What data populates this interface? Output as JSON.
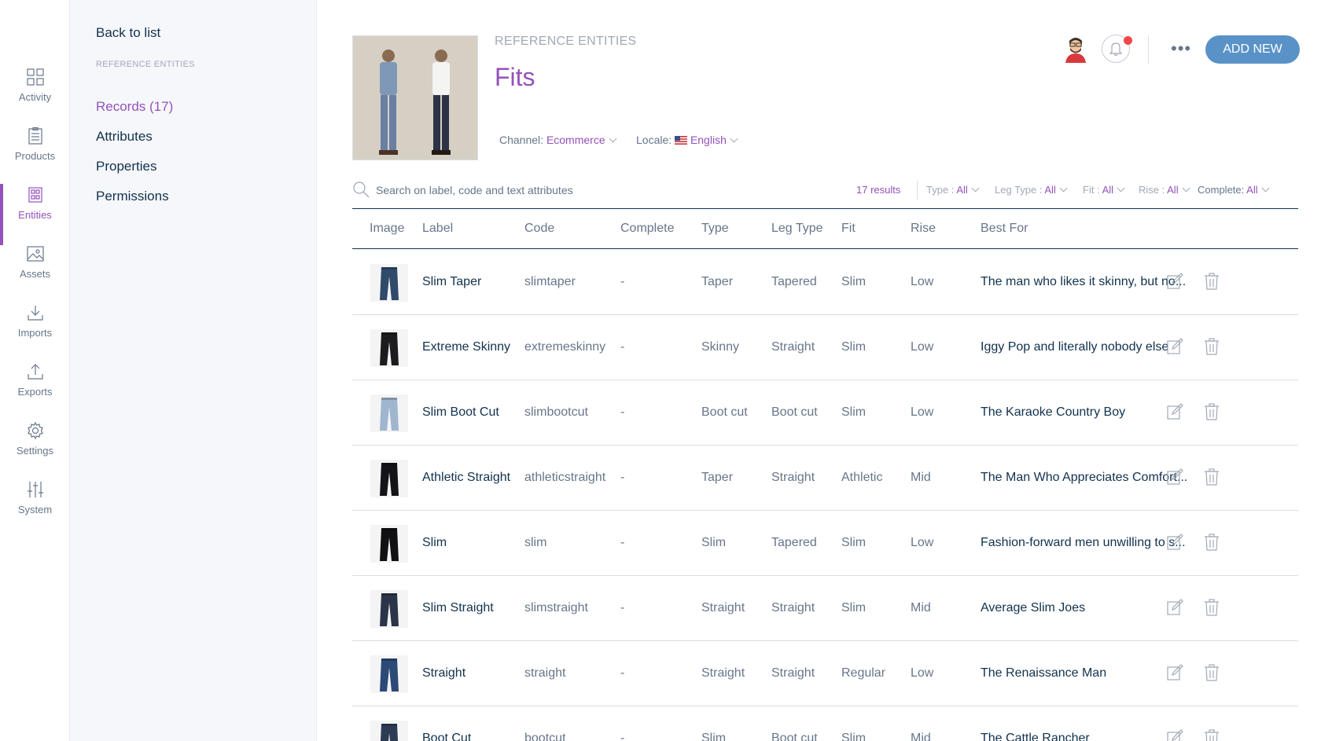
{
  "nav": [
    {
      "label": "Activity",
      "icon": "dashboard-icon"
    },
    {
      "label": "Products",
      "icon": "clipboard-icon"
    },
    {
      "label": "Entities",
      "icon": "entities-icon"
    },
    {
      "label": "Assets",
      "icon": "image-icon"
    },
    {
      "label": "Imports",
      "icon": "download-icon"
    },
    {
      "label": "Exports",
      "icon": "upload-icon"
    },
    {
      "label": "Settings",
      "icon": "gear-icon"
    },
    {
      "label": "System",
      "icon": "sliders-icon"
    }
  ],
  "subnav": {
    "back": "Back to list",
    "section": "REFERENCE ENTITIES",
    "items": [
      "Records (17)",
      "Attributes",
      "Properties",
      "Permissions"
    ]
  },
  "header": {
    "breadcrumb": "REFERENCE ENTITIES",
    "title": "Fits",
    "channel_label": "Channel:",
    "channel_value": "Ecommerce",
    "locale_label": "Locale:",
    "locale_value": "English",
    "add_button": "ADD NEW",
    "more": "•••"
  },
  "search": {
    "placeholder": "Search on label, code and text attributes",
    "results": "17 results",
    "filters": [
      {
        "label": "Type :",
        "value": "All"
      },
      {
        "label": "Leg Type :",
        "value": "All"
      },
      {
        "label": "Fit :",
        "value": "All"
      },
      {
        "label": "Rise :",
        "value": "All"
      },
      {
        "label": "Complete:",
        "value": "All"
      }
    ]
  },
  "table": {
    "columns": [
      "Image",
      "Label",
      "Code",
      "Complete",
      "Type",
      "Leg Type",
      "Fit",
      "Rise",
      "Best For"
    ],
    "rows": [
      {
        "label": "Slim Taper",
        "code": "slimtaper",
        "complete": "-",
        "type": "Taper",
        "leg": "Tapered",
        "fit": "Slim",
        "rise": "Low",
        "best": "The man who likes it skinny, but no..."
      },
      {
        "label": "Extreme Skinny",
        "code": "extremeskinny",
        "complete": "-",
        "type": "Skinny",
        "leg": "Straight",
        "fit": "Slim",
        "rise": "Low",
        "best": "Iggy Pop and literally nobody else"
      },
      {
        "label": "Slim Boot Cut",
        "code": "slimbootcut",
        "complete": "-",
        "type": "Boot cut",
        "leg": "Boot cut",
        "fit": "Slim",
        "rise": "Low",
        "best": "The Karaoke Country Boy"
      },
      {
        "label": "Athletic Straight",
        "code": "athleticstraight",
        "complete": "-",
        "type": "Taper",
        "leg": "Straight",
        "fit": "Athletic",
        "rise": "Mid",
        "best": "The Man Who Appreciates Comfort..."
      },
      {
        "label": "Slim",
        "code": "slim",
        "complete": "-",
        "type": "Slim",
        "leg": "Tapered",
        "fit": "Slim",
        "rise": "Low",
        "best": "Fashion-forward men unwilling to s..."
      },
      {
        "label": "Slim Straight",
        "code": "slimstraight",
        "complete": "-",
        "type": "Straight",
        "leg": "Straight",
        "fit": "Slim",
        "rise": "Mid",
        "best": "Average Slim Joes"
      },
      {
        "label": "Straight",
        "code": "straight",
        "complete": "-",
        "type": "Straight",
        "leg": "Straight",
        "fit": "Regular",
        "rise": "Low",
        "best": "The Renaissance Man"
      },
      {
        "label": "Boot Cut",
        "code": "bootcut",
        "complete": "-",
        "type": "Slim",
        "leg": "Boot cut",
        "fit": "Slim",
        "rise": "Mid",
        "best": "The Cattle Rancher"
      }
    ]
  },
  "colors": {
    "accent": "#9452ba",
    "button": "#5992c7",
    "text": "#11324d",
    "muted": "#67768a"
  }
}
